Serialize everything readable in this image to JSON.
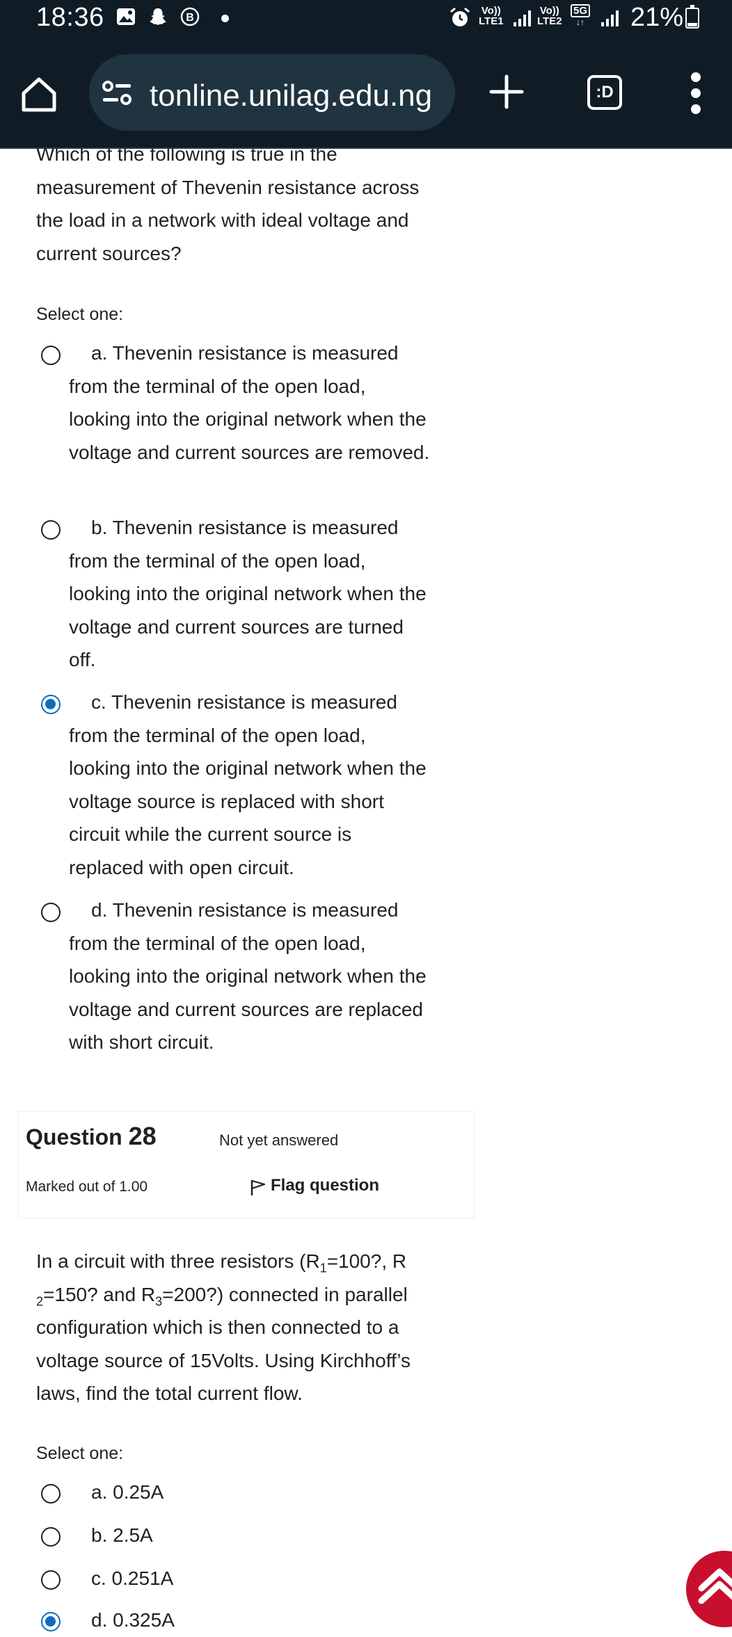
{
  "status_bar": {
    "time": "18:36",
    "net1_label_top": "Vo))",
    "net1_label_bottom": "LTE1",
    "net2_label_top": "Vo))",
    "net2_label_bottom": "LTE2",
    "net_type": "5G",
    "battery_percent": "21%",
    "battery_level": 0.21
  },
  "browser": {
    "url": "tonline.unilag.edu.ng",
    "tabs_label": ":D"
  },
  "question_27": {
    "text_line_1": "Which of the following is true in the",
    "text_line_2": "measurement of Thevenin resistance across",
    "text_line_3": "the load in a network with ideal voltage and",
    "text_line_4": "current sources?",
    "select_label": "Select one:",
    "options": [
      {
        "text": "a. Thevenin resistance is measured from the terminal of the open load, looking into the original network when the voltage and current sources are removed.",
        "selected": false
      },
      {
        "text": "b. Thevenin resistance is measured from the terminal of the open load, looking into the original network when the voltage and current sources are turned off.",
        "selected": false
      },
      {
        "text": "c. Thevenin resistance is measured from the terminal of the open load, looking into the original network when the voltage source is replaced with short circuit while the current source is replaced with open circuit.",
        "selected": true
      },
      {
        "text": "d. Thevenin resistance is measured from the terminal of the open load, looking into the original network when the voltage and current sources are replaced with short circuit.",
        "selected": false
      }
    ]
  },
  "question_28": {
    "label": "Question",
    "number": "28",
    "state": "Not yet answered",
    "marked": "Marked out of 1.00",
    "flag_label": "Flag question",
    "text_p1": "In a circuit with three resistors (R",
    "text_sub1": "1",
    "text_p2": "=100?, R",
    "text_sub2": "2",
    "text_p3": "=150? and R",
    "text_sub3": "3",
    "text_p4": "=200?) connected in parallel configuration which is then connected to a voltage source of 15Volts. Using Kirchhoff’s laws, find the total current flow.",
    "select_label": "Select one:",
    "options": [
      {
        "text": "a. 0.25A",
        "selected": false
      },
      {
        "text": "b. 2.5A",
        "selected": false
      },
      {
        "text": "c. 0.251A",
        "selected": false
      },
      {
        "text": "d. 0.325A",
        "selected": true
      }
    ]
  }
}
